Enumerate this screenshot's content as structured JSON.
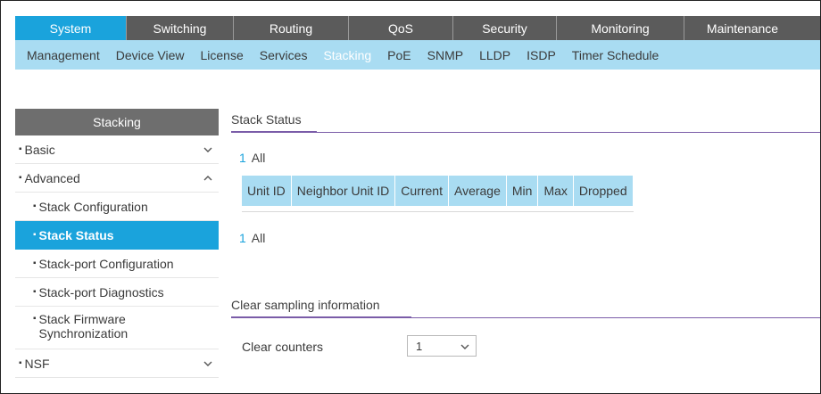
{
  "top_nav": {
    "tabs": [
      "System",
      "Switching",
      "Routing",
      "QoS",
      "Security",
      "Monitoring",
      "Maintenance"
    ],
    "active": "System"
  },
  "sub_nav": {
    "items": [
      "Management",
      "Device View",
      "License",
      "Services",
      "Stacking",
      "PoE",
      "SNMP",
      "LLDP",
      "ISDP",
      "Timer Schedule"
    ],
    "active": "Stacking"
  },
  "sidebar": {
    "header": "Stacking",
    "items": [
      {
        "label": "Basic",
        "bullet": "▪",
        "chevron": "down"
      },
      {
        "label": "Advanced",
        "bullet": "▪",
        "chevron": "up"
      },
      {
        "label": "Stack Configuration",
        "bullet": "▪"
      },
      {
        "label": "Stack Status",
        "bullet": "▪",
        "active": true
      },
      {
        "label": "Stack-port Configuration",
        "bullet": "▪"
      },
      {
        "label": "Stack-port Diagnostics",
        "bullet": "▪"
      },
      {
        "label_line1": "Stack Firmware",
        "label_line2": "Synchronization",
        "bullet": "▪"
      },
      {
        "label": "NSF",
        "bullet": "▪",
        "chevron": "down"
      }
    ]
  },
  "main": {
    "stack_status": {
      "title": "Stack Status",
      "unit_link_num": "1",
      "unit_link_text": "All",
      "columns": [
        "Unit ID",
        "Neighbor Unit ID",
        "Current",
        "Average",
        "Min",
        "Max",
        "Dropped"
      ],
      "bottom_link_num": "1",
      "bottom_link_text": "All"
    },
    "clear_sampling": {
      "title": "Clear sampling information",
      "counters_label": "Clear counters",
      "counters_value": "1"
    }
  },
  "colors": {
    "accent": "#1aa3dc",
    "subnav_bg": "#a9dcf2",
    "topnav_bg": "#5b5b5b",
    "section_line": "#7a5ca8"
  },
  "icons": {
    "chevron_down": "chevron-down-icon",
    "chevron_up": "chevron-up-icon"
  }
}
